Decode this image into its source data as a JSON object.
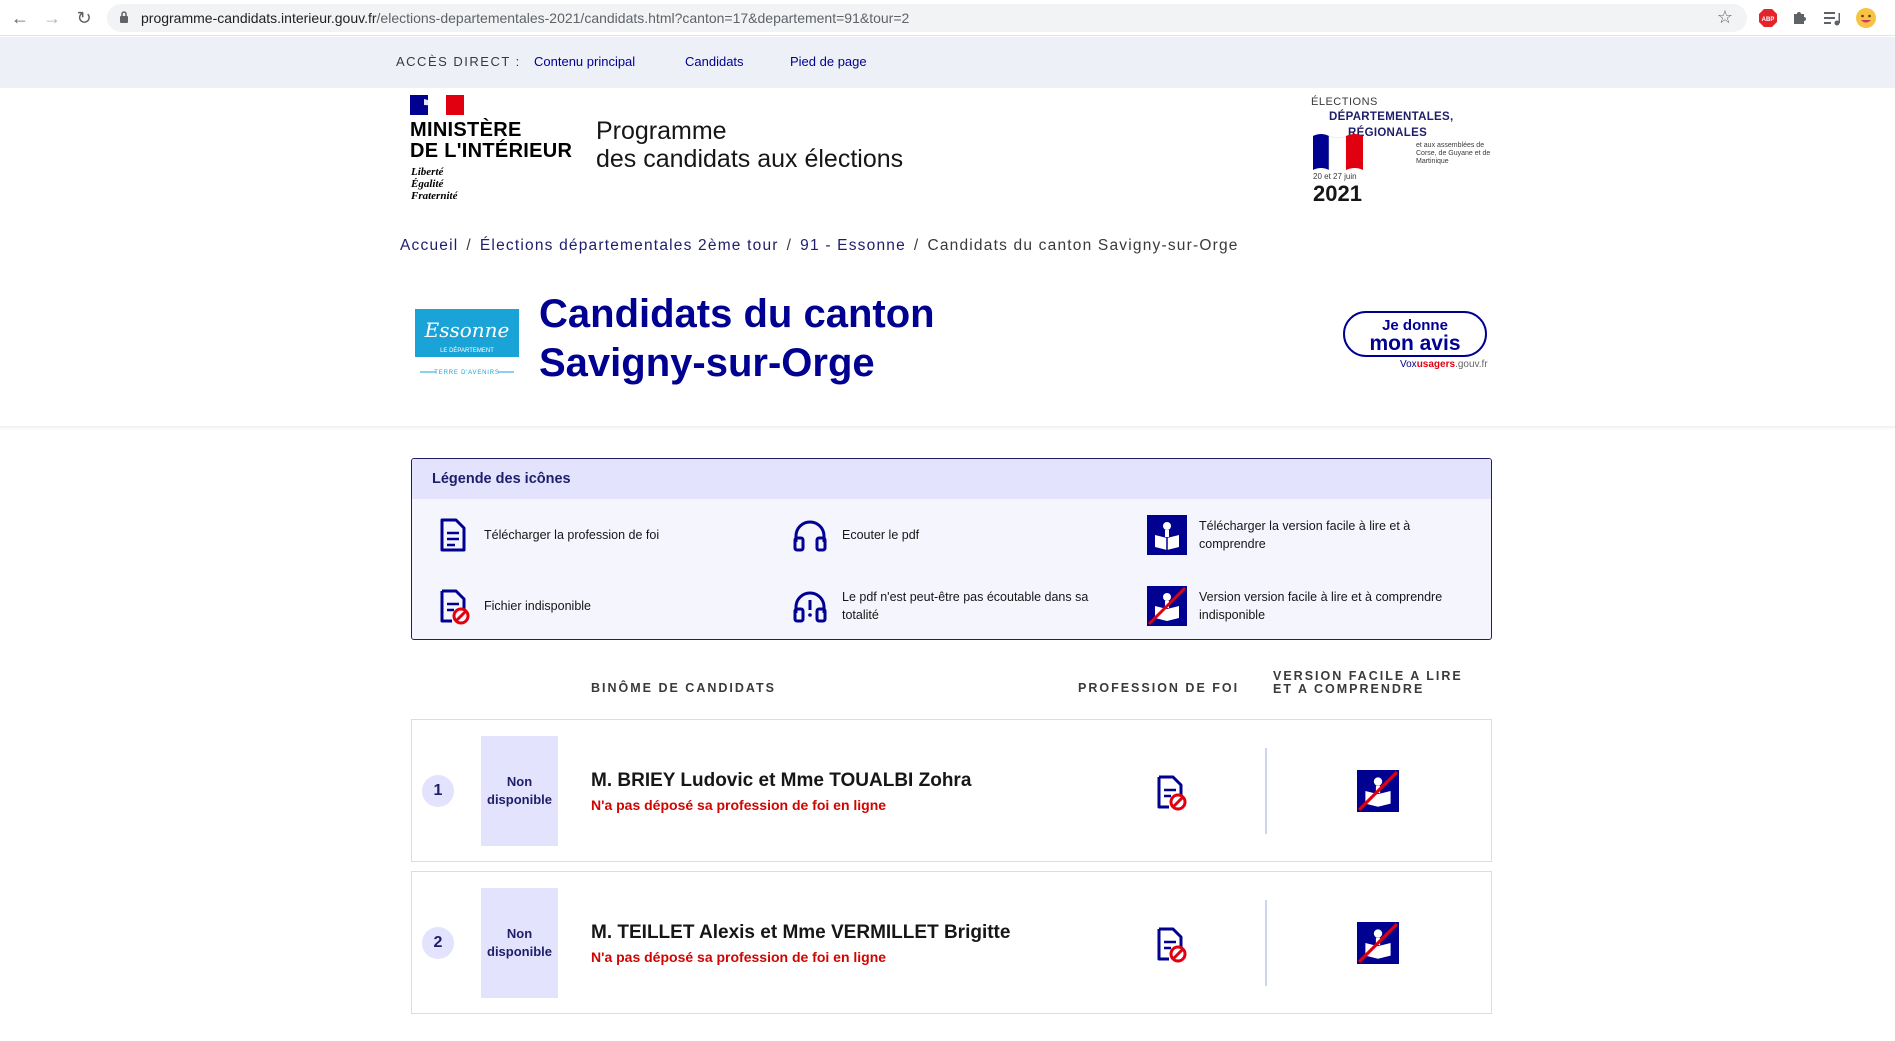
{
  "browser": {
    "url_host": "programme-candidats.interieur.gouv.fr",
    "url_path": "/elections-departementales-2021/candidats.html?canton=17&departement=91&tour=2",
    "ext_abp": "ABP"
  },
  "skip": {
    "label": "ACCÈS DIRECT :",
    "links": [
      "Contenu principal",
      "Candidats",
      "Pied de page"
    ]
  },
  "header": {
    "ministere_l1": "MINISTÈRE",
    "ministere_l2": "DE L'INTÉRIEUR",
    "devise": [
      "Liberté",
      "Égalité",
      "Fraternité"
    ],
    "service_l1": "Programme",
    "service_l2": "des candidats aux élections",
    "elections": {
      "small": "ÉLECTIONS",
      "big_l1": "DÉPARTEMENTALES,",
      "big_l2": "RÉGIONALES",
      "sub": "et aux assemblées de Corse, de Guyane et de Martinique",
      "date": "20 et 27 juin",
      "year": "2021"
    }
  },
  "breadcrumb": {
    "items": [
      "Accueil",
      "Élections départementales 2ème tour",
      "91 - Essonne"
    ],
    "current": "Candidats du canton Savigny-sur-Orge"
  },
  "page": {
    "title_l1": "Candidats du canton",
    "title_l2": "Savigny-sur-Orge",
    "essonne_logo_text": "Essonne",
    "essonne_band": "LE DÉPARTEMENT",
    "essonne_tag": "TERRE D'AVENIRS",
    "avis_l1": "Je donne",
    "avis_l2": "mon avis",
    "vox_a": "Vox",
    "vox_b": "usagers",
    "vox_c": ".gouv.fr"
  },
  "legend": {
    "title": "Légende des icônes",
    "items": [
      {
        "icon": "document-icon",
        "text": "Télécharger la profession de foi"
      },
      {
        "icon": "headphones-icon",
        "text": "Ecouter le pdf"
      },
      {
        "icon": "easy-read-icon",
        "text": "Télécharger la version facile à lire et à comprendre"
      },
      {
        "icon": "document-unavailable-icon",
        "text": "Fichier indisponible"
      },
      {
        "icon": "headphones-partial-icon",
        "text": "Le pdf n'est peut-être pas écoutable dans sa totalité"
      },
      {
        "icon": "easy-read-unavailable-icon",
        "text": "Version version facile à lire et à comprendre indisponible"
      }
    ]
  },
  "table": {
    "col_binome": "BINÔME DE CANDIDATS",
    "col_profession": "PROFESSION DE FOI",
    "col_falc_l1": "VERSION FACILE A LIRE",
    "col_falc_l2": "ET A COMPRENDRE",
    "rows": [
      {
        "num": "1",
        "photo_l1": "Non",
        "photo_l2": "disponible",
        "name": "M. BRIEY Ludovic et Mme TOUALBI Zohra",
        "status": "N'a pas déposé sa profession de foi en ligne"
      },
      {
        "num": "2",
        "photo_l1": "Non",
        "photo_l2": "disponible",
        "name": "M. TEILLET Alexis et Mme VERMILLET Brigitte",
        "status": "N'a pas déposé sa profession de foi en ligne"
      }
    ]
  },
  "colors": {
    "primary": "#000091",
    "danger": "#ce0500",
    "accent_light": "#e3e3fd"
  }
}
